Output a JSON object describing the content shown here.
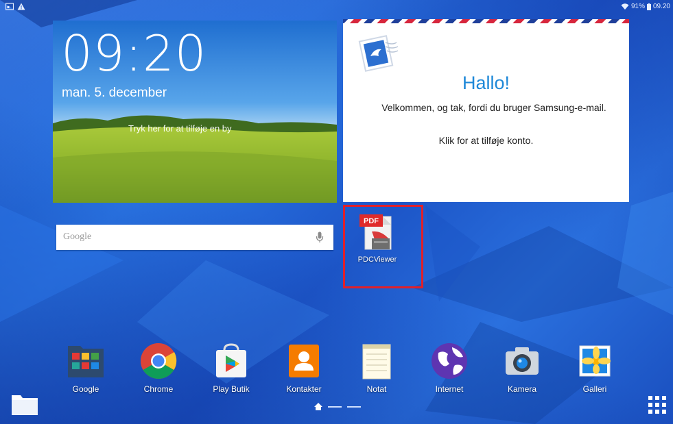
{
  "status_bar": {
    "left_icons": [
      "screenshot-icon",
      "warning-icon"
    ],
    "battery_text": "91%",
    "time": "09.20"
  },
  "clock_widget": {
    "time": "09:20",
    "date": "man. 5. december",
    "city_prompt": "Tryk her for at tilføje en by"
  },
  "email_widget": {
    "title": "Hallo!",
    "message": "Velkommen, og tak, fordi du bruger Samsung-e-mail.",
    "action": "Klik for at tilføje konto."
  },
  "search": {
    "placeholder": "Google"
  },
  "highlighted_app": {
    "label": "PDCViewer",
    "badge": "PDF",
    "highlight_color": "#e0202a"
  },
  "dock": {
    "apps": [
      {
        "label": "Google",
        "icon": "google-folder-icon"
      },
      {
        "label": "Chrome",
        "icon": "chrome-icon"
      },
      {
        "label": "Play Butik",
        "icon": "play-store-icon"
      },
      {
        "label": "Kontakter",
        "icon": "contacts-icon"
      },
      {
        "label": "Notat",
        "icon": "notepad-icon"
      },
      {
        "label": "Internet",
        "icon": "globe-icon"
      },
      {
        "label": "Kamera",
        "icon": "camera-icon"
      },
      {
        "label": "Galleri",
        "icon": "gallery-icon"
      }
    ]
  },
  "colors": {
    "wallpaper": "#1f62d4",
    "email_title": "#1e88d8"
  }
}
